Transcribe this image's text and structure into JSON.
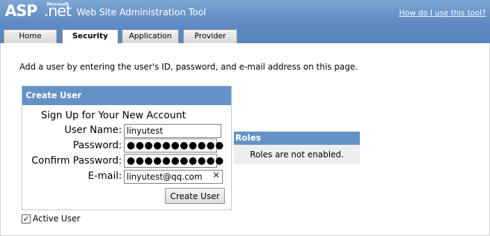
{
  "header": {
    "logo_asp": "ASP",
    "logo_net": ".net",
    "logo_microsoft": "Microsoft",
    "title": "Web Site Administration Tool",
    "help_link": "How do I use this tool?"
  },
  "tabs": [
    {
      "label": "Home",
      "active": false
    },
    {
      "label": "Security",
      "active": true
    },
    {
      "label": "Application",
      "active": false
    },
    {
      "label": "Provider",
      "active": false
    }
  ],
  "intro_text": "Add a user by entering the user's ID, password, and e-mail address on this page.",
  "create_user": {
    "header": "Create User",
    "subtitle": "Sign Up for Your New Account",
    "username_label": "User Name:",
    "username_value": "linyutest",
    "password_label": "Password:",
    "password_value": "●●●●●●●●●●●",
    "confirm_label": "Confirm Password:",
    "confirm_value": "●●●●●●●●●●●",
    "email_label": "E-mail:",
    "email_value": "linyutest@qq.com",
    "clear_glyph": "✕",
    "button": "Create User"
  },
  "roles": {
    "header": "Roles",
    "message": "Roles are not enabled."
  },
  "active_user": {
    "label": "Active User",
    "checked": true,
    "check_glyph": "✓"
  },
  "colors": {
    "header_bg": "#5e89c2",
    "panel_header_bg": "#6592c6",
    "roles_bg": "#eeeeee"
  }
}
